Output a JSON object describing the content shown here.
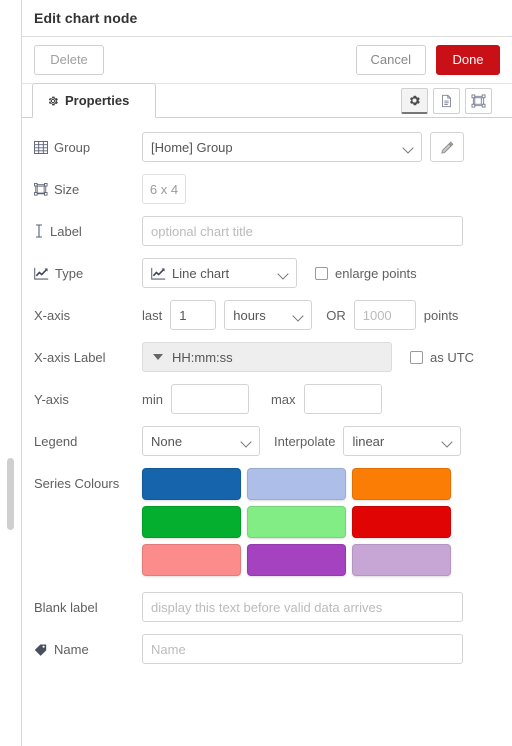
{
  "header": {
    "title": "Edit chart node"
  },
  "toolbar": {
    "delete_label": "Delete",
    "cancel_label": "Cancel",
    "done_label": "Done",
    "done_color": "#c81016"
  },
  "tabs": {
    "properties_label": "Properties",
    "icons": [
      {
        "name": "gear-icon",
        "active": true
      },
      {
        "name": "description-icon",
        "active": false
      },
      {
        "name": "appearance-icon",
        "active": false
      }
    ]
  },
  "form": {
    "group": {
      "label": "Group",
      "icon": "table-icon",
      "value": "[Home] Group",
      "edit_icon": "pencil-icon"
    },
    "size": {
      "label": "Size",
      "icon": "object-group-icon",
      "value": "6 x 4"
    },
    "chart_label": {
      "label": "Label",
      "icon": "text-cursor-icon",
      "value": "",
      "placeholder": "optional chart title"
    },
    "type": {
      "label": "Type",
      "icon": "line-chart-icon",
      "value": "Line chart",
      "enlarge_points_label": "enlarge points",
      "enlarge_points_checked": false
    },
    "xaxis": {
      "label": "X-axis",
      "last_label": "last",
      "count_value": "1",
      "unit_value": "hours",
      "or_label": "OR",
      "points_value": "",
      "points_placeholder": "1000",
      "points_label": "points"
    },
    "xaxis_label": {
      "label": "X-axis Label",
      "value": "HH:mm:ss",
      "as_utc_label": "as UTC",
      "as_utc_checked": false
    },
    "yaxis": {
      "label": "Y-axis",
      "min_label": "min",
      "min_value": "",
      "max_label": "max",
      "max_value": ""
    },
    "legend": {
      "label": "Legend",
      "value": "None",
      "interpolate_label": "Interpolate",
      "interpolate_value": "linear"
    },
    "series_colours": {
      "label": "Series Colours",
      "rows": [
        [
          "#1664ac",
          "#adbfe8",
          "#fb7d05"
        ],
        [
          "#04ae2f",
          "#82ec85",
          "#e10404"
        ],
        [
          "#fc8b8b",
          "#a442c0",
          "#c7a6d6"
        ]
      ]
    },
    "blank_label": {
      "label": "Blank label",
      "value": "",
      "placeholder": "display this text before valid data arrives"
    },
    "name": {
      "label": "Name",
      "icon": "tag-icon",
      "value": "",
      "placeholder": "Name"
    }
  }
}
